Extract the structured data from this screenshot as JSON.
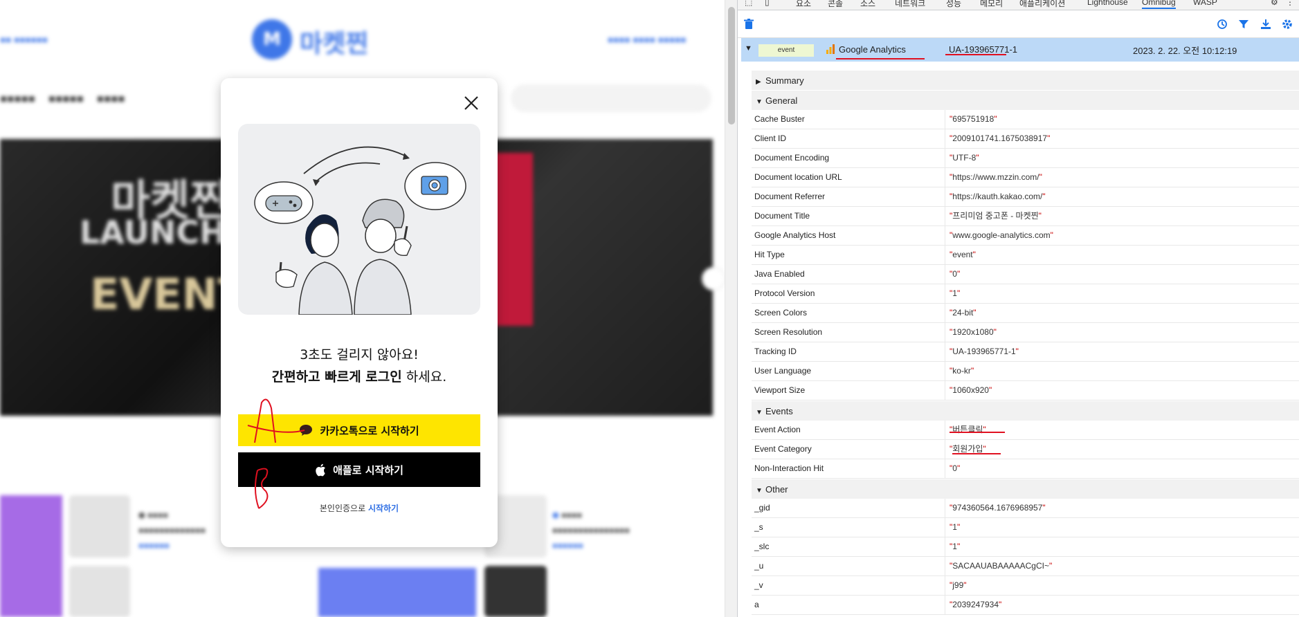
{
  "site": {
    "logo_char": "M",
    "logo_text": "마켓찐",
    "hero": {
      "line1": "마켓찐",
      "line2": "LAUNCHIN",
      "line3": "EVENT"
    }
  },
  "modal": {
    "line1": "3초도 걸리지 않아요!",
    "line2_bold": "간편하고 빠르게 로그인",
    "line2_rest": " 하세요.",
    "kakao_button": "카카오톡으로 시작하기",
    "apple_button": "애플로 시작하기",
    "verify_prefix": "본인인증으로 ",
    "verify_link": "시작하기",
    "colors": {
      "kakao": "#fee500",
      "apple": "#000000",
      "link": "#2f6fe4"
    }
  },
  "devtools": {
    "tabs": [
      "요소",
      "콘솔",
      "소스",
      "네트워크",
      "성능",
      "메모리",
      "애플리케이션",
      "Lighthouse",
      "Omnibug",
      "WASP"
    ],
    "active_tab": "Omnibug",
    "hit": {
      "type_badge": "event",
      "provider": "Google Analytics",
      "tracking_id": "UA-193965771-1",
      "timestamp": "2023. 2. 22. 오전 10:12:19"
    },
    "summary_label": "Summary",
    "sections": [
      {
        "title": "General",
        "rows": [
          [
            "Cache Buster",
            "695751918"
          ],
          [
            "Client ID",
            "2009101741.1675038917"
          ],
          [
            "Document Encoding",
            "UTF-8"
          ],
          [
            "Document location URL",
            "https://www.mzzin.com/"
          ],
          [
            "Document Referrer",
            "https://kauth.kakao.com/"
          ],
          [
            "Document Title",
            "프리미엄 중고폰 - 마켓찐"
          ],
          [
            "Google Analytics Host",
            "www.google-analytics.com"
          ],
          [
            "Hit Type",
            "event"
          ],
          [
            "Java Enabled",
            "0"
          ],
          [
            "Protocol Version",
            "1"
          ],
          [
            "Screen Colors",
            "24-bit"
          ],
          [
            "Screen Resolution",
            "1920x1080"
          ],
          [
            "Tracking ID",
            "UA-193965771-1"
          ],
          [
            "User Language",
            "ko-kr"
          ],
          [
            "Viewport Size",
            "1060x920"
          ]
        ]
      },
      {
        "title": "Events",
        "rows": [
          [
            "Event Action",
            "버튼클릭"
          ],
          [
            "Event Category",
            "회원가입"
          ],
          [
            "Non-Interaction Hit",
            "0"
          ]
        ]
      },
      {
        "title": "Other",
        "rows": [
          [
            "_gid",
            "974360564.1676968957"
          ],
          [
            "_s",
            "1"
          ],
          [
            "_slc",
            "1"
          ],
          [
            "_u",
            "SACAAUABAAAAACgCI~"
          ],
          [
            "_v",
            "j99"
          ],
          [
            "a",
            "2039247934"
          ]
        ]
      }
    ]
  }
}
